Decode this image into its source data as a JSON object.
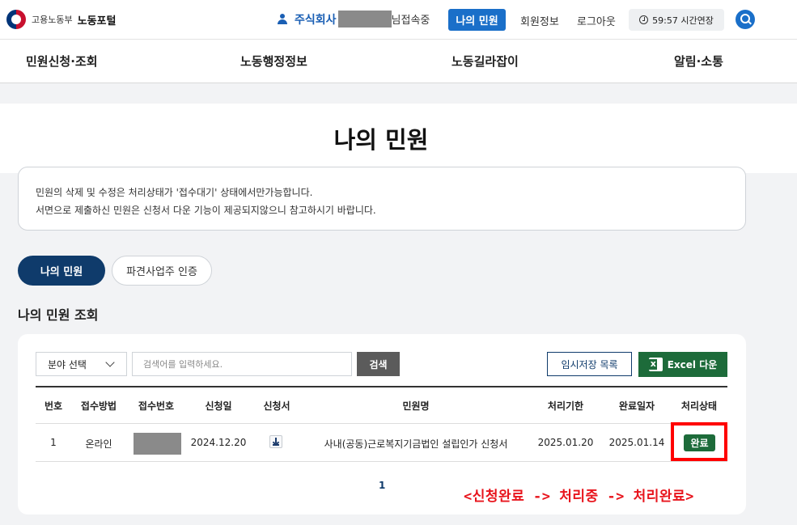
{
  "header": {
    "ministry": "고용노동부",
    "portal_name": "노동포털",
    "company": "주식회사",
    "connected_text": "님접속중",
    "my_complaints": "나의 민원",
    "member_info": "회원정보",
    "logout": "로그아웃",
    "timer": "59:57 시간연장",
    "accent_color": "#1a6fc9"
  },
  "nav": {
    "items": [
      "민원신청·조회",
      "노동행정정보",
      "노동길라잡이",
      "알림·소통"
    ]
  },
  "page": {
    "title": "나의 민원"
  },
  "notice": {
    "line1": "민원의 삭제 및 수정은 처리상태가 '접수대기' 상태에서만가능합니다.",
    "line2": "서면으로 제출하신 민원은 신청서 다운 기능이 제공되지않으니 참고하시기 바랍니다."
  },
  "tabs": [
    "나의 민원",
    "파견사업주 인증"
  ],
  "section": {
    "title": "나의 민원 조회"
  },
  "filters": {
    "field_select": "분야 선택",
    "search_placeholder": "검색어를 입력하세요.",
    "search_button": "검색",
    "temp_save_button": "임시저장 목록",
    "excel_button": "Excel 다운"
  },
  "table": {
    "headers": [
      "번호",
      "접수방법",
      "접수번호",
      "신청일",
      "신청서",
      "민원명",
      "처리기한",
      "완료일자",
      "처리상태"
    ],
    "rows": [
      {
        "no": "1",
        "method": "온라인",
        "applied": "2024.12.20",
        "title": "사내(공동)근로복지기금법인 설립인가 신청서",
        "deadline": "2025.01.20",
        "completed": "2025.01.14",
        "status": "완료"
      }
    ]
  },
  "pagination": {
    "current": "1"
  },
  "annotation": "<신청완료 -> 처리중 -> 처리완료>"
}
